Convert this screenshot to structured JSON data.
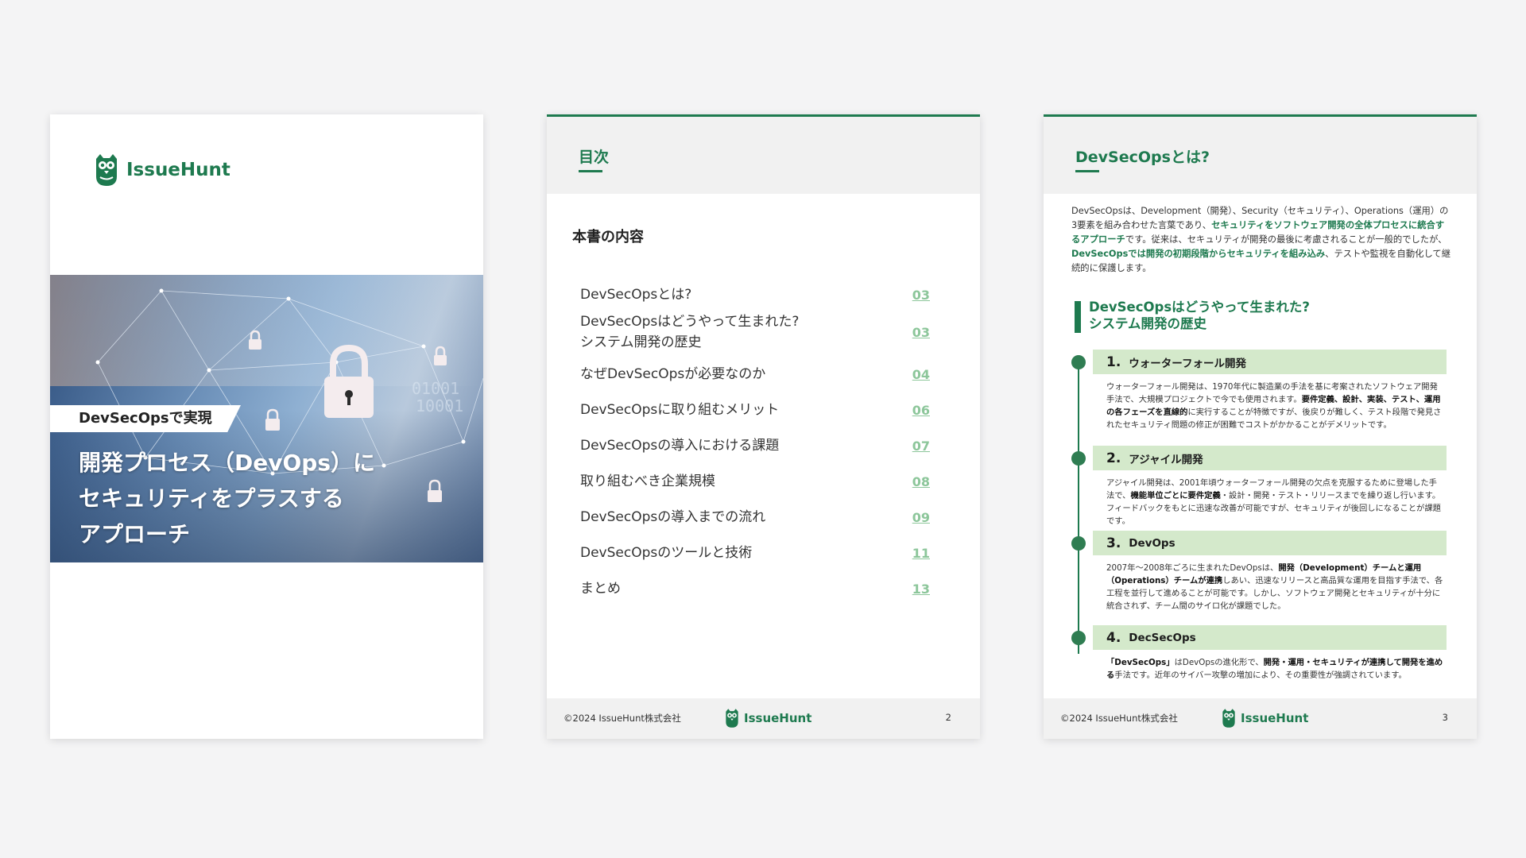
{
  "brand": {
    "name": "IssueHunt",
    "color": "#1e7a4f"
  },
  "cover": {
    "badge": "DevSecOpsで実現",
    "title_lines": [
      "開発プロセス（DevOps）に",
      "セキュリティをプラスする",
      "アプローチ"
    ]
  },
  "toc_page": {
    "header": "目次",
    "heading": "本書の内容",
    "items": [
      {
        "lines": [
          "DevSecOpsとは?"
        ],
        "page": "03"
      },
      {
        "lines": [
          "DevSecOpsはどうやって生まれた?",
          "システム開発の歴史"
        ],
        "page": "03"
      },
      {
        "lines": [
          "なぜDevSecOpsが必要なのか"
        ],
        "page": "04"
      },
      {
        "lines": [
          "DevSecOpsに取り組むメリット"
        ],
        "page": "06"
      },
      {
        "lines": [
          "DevSecOpsの導入における課題"
        ],
        "page": "07"
      },
      {
        "lines": [
          "取り組むべき企業規模"
        ],
        "page": "08"
      },
      {
        "lines": [
          "DevSecOpsの導入までの流れ"
        ],
        "page": "09"
      },
      {
        "lines": [
          "DevSecOpsのツールと技術"
        ],
        "page": "11"
      },
      {
        "lines": [
          "まとめ"
        ],
        "page": "13"
      }
    ],
    "footer": {
      "copyright": "©2024 IssueHunt株式会社",
      "page_number": "2"
    }
  },
  "content_page": {
    "header": "DevSecOpsとは?",
    "intro": [
      {
        "text": "DevSecOpsは、Development（開発）、Security（セキュリティ）、Operations（運用）の3要素を組み合わせた言葉であり、"
      },
      {
        "text": "セキュリティをソフトウェア開発の全体プロセスに統合するアプローチ",
        "highlight": true
      },
      {
        "text": "です。従来は、セキュリティが開発の最後に考慮されることが一般的でしたが、"
      },
      {
        "text": "DevSecOpsでは開発の初期段階からセキュリティを組み込み",
        "highlight": true
      },
      {
        "text": "、テストや監視を自動化して継続的に保護します。"
      }
    ],
    "section_title_lines": [
      "DevSecOpsはどうやって生まれた?",
      "システム開発の歴史"
    ],
    "steps": [
      {
        "number": "1.",
        "label": "ウォーターフォール開発",
        "body": [
          {
            "text": "ウォーターフォール開発は、1970年代に製造業の手法を基に考案されたソフトウェア開発手法で、大規模プロジェクトで今でも使用されます。"
          },
          {
            "text": "要件定義、設計、実装、テスト、運用の各フェーズを直線的",
            "bold": true
          },
          {
            "text": "に実行することが特徴ですが、後戻りが難しく、テスト段階で発見されたセキュリティ問題の修正が困難でコストがかかることがデメリットです。"
          }
        ]
      },
      {
        "number": "2.",
        "label": "アジャイル開発",
        "body": [
          {
            "text": "アジャイル開発は、2001年頃ウォーターフォール開発の欠点を克服するために登場した手法で、"
          },
          {
            "text": "機能単位ごとに要件定義",
            "bold": true
          },
          {
            "text": "・設計・開発・テスト・リリースまでを繰り返し行います。フィードバックをもとに迅速な改善が可能ですが、セキュリティが後回しになることが課題です。"
          }
        ]
      },
      {
        "number": "3.",
        "label": "DevOps",
        "body": [
          {
            "text": "2007年〜2008年ごろに生まれたDevOpsは、"
          },
          {
            "text": "開発（Development）チームと運用（Operations）チームが連携",
            "bold": true
          },
          {
            "text": "しあい、迅速なリリースと高品質な運用を目指す手法で、各工程を並行して進めることが可能です。しかし、ソフトウェア開発とセキュリティが十分に統合されず、チーム間のサイロ化が課題でした。"
          }
        ]
      },
      {
        "number": "4.",
        "label": "DecSecOps",
        "body": [
          {
            "text": "「DevSecOps」",
            "bold": true
          },
          {
            "text": "はDevOpsの進化形で、"
          },
          {
            "text": "開発・運用・セキュリティが連携して開発を進める",
            "bold": true
          },
          {
            "text": "手法です。近年のサイバー攻撃の増加により、その重要性が強調されています。"
          }
        ]
      }
    ],
    "footer": {
      "copyright": "©2024 IssueHunt株式会社",
      "page_number": "3"
    }
  }
}
